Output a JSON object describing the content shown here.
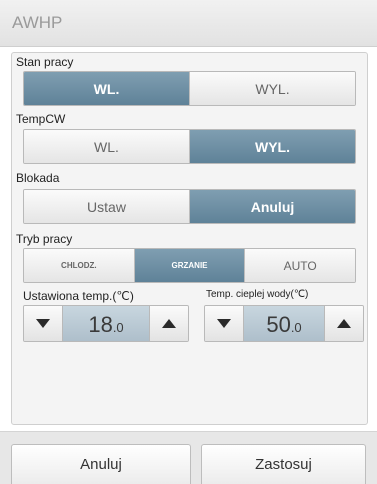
{
  "app": {
    "title": "AWHP"
  },
  "stan_pracy": {
    "label": "Stan pracy",
    "options": [
      "WL.",
      "WYL."
    ],
    "selected": "WL."
  },
  "temp_cw": {
    "label": "TempCW",
    "options": [
      "WL.",
      "WYL."
    ],
    "selected": "WYL."
  },
  "blokada": {
    "label": "Blokada",
    "options": [
      "Ustaw",
      "Anuluj"
    ],
    "selected": "Anuluj"
  },
  "tryb_pracy": {
    "label": "Tryb pracy",
    "options": [
      "CHLODZ.",
      "GRZANIE",
      "AUTO"
    ],
    "selected": "GRZANIE"
  },
  "set_temp": {
    "label": "Ustawiona temp.(℃)",
    "value_int": "18",
    "value_dec": ".0"
  },
  "water_temp": {
    "label": "Temp. cieplej wody(℃)",
    "value_int": "50",
    "value_dec": ".0"
  },
  "footer": {
    "cancel_label": "Anuluj",
    "apply_label": "Zastosuj"
  },
  "colors": {
    "active": "#6a8ba0",
    "title": "#9a9a9a"
  },
  "icons": {
    "decrease": "triangle-down-icon",
    "increase": "triangle-up-icon"
  }
}
